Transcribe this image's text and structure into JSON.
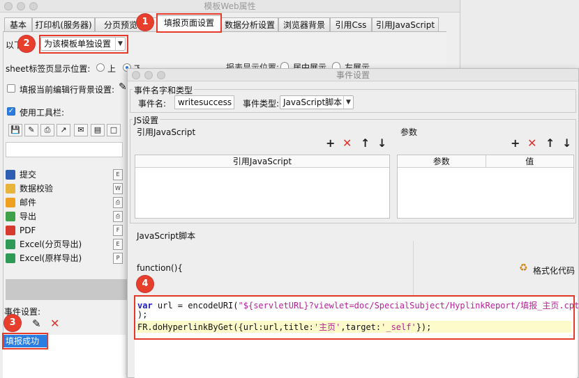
{
  "win1": {
    "title": "模板Web属性",
    "tabs": [
      "基本",
      "打印机(服务器)",
      "分页预览",
      "填报页面设置",
      "数据分析设置",
      "浏览器背景",
      "引用Css",
      "引用JavaScript"
    ],
    "selected_tab": "填报页面设置",
    "mode_prefix": "以下",
    "mode_select": "为该模板单独设置",
    "sheet_label": "sheet标签页显示位置:",
    "sheet_opt_top": "上",
    "sheet_opt_bottom": "下",
    "report_pos_label": "报表显示位置:",
    "report_pos_center": "居中展示",
    "report_pos_left": "左展示",
    "bg_checkbox": "填报当前编辑行背景设置:",
    "toolbar_checkbox": "使用工具栏:",
    "buttons": [
      "提交",
      "数据校验",
      "邮件",
      "导出",
      "PDF",
      "Excel(分页导出)",
      "Excel(原样导出)"
    ],
    "event_label": "事件设置:",
    "event_item": "填报成功"
  },
  "win2": {
    "title": "事件设置",
    "group_name_type": "事件名字和类型",
    "event_name_label": "事件名:",
    "event_name_value": "writesuccess",
    "event_type_label": "事件类型:",
    "event_type_value": "JavaScript脚本",
    "group_js": "JS设置",
    "ref_js_label": "引用JavaScript",
    "param_label": "参数",
    "table_ref_header": "引用JavaScript",
    "table_param_headers": [
      "参数",
      "值"
    ],
    "script_label": "JavaScript脚本",
    "function_text": "function(){",
    "format_code": "格式化代码",
    "code_line1_kw": "var",
    "code_line1_a": " url = encodeURI(",
    "code_line1_str": "\"${servletURL}?viewlet=doc/SpecialSubject/HyplinkReport/填报_主页.cpt\"",
    "code_line2": ");",
    "code_line3_a": "FR.doHyperlinkByGet({url:url,title:",
    "code_line3_s1": "'主页'",
    "code_line3_b": ",target:",
    "code_line3_s2": "'_self'",
    "code_line3_c": "});"
  },
  "badges": [
    "1",
    "2",
    "3",
    "4"
  ],
  "colors": {
    "accent": "#e53a2a",
    "selection": "#2a7de1"
  }
}
